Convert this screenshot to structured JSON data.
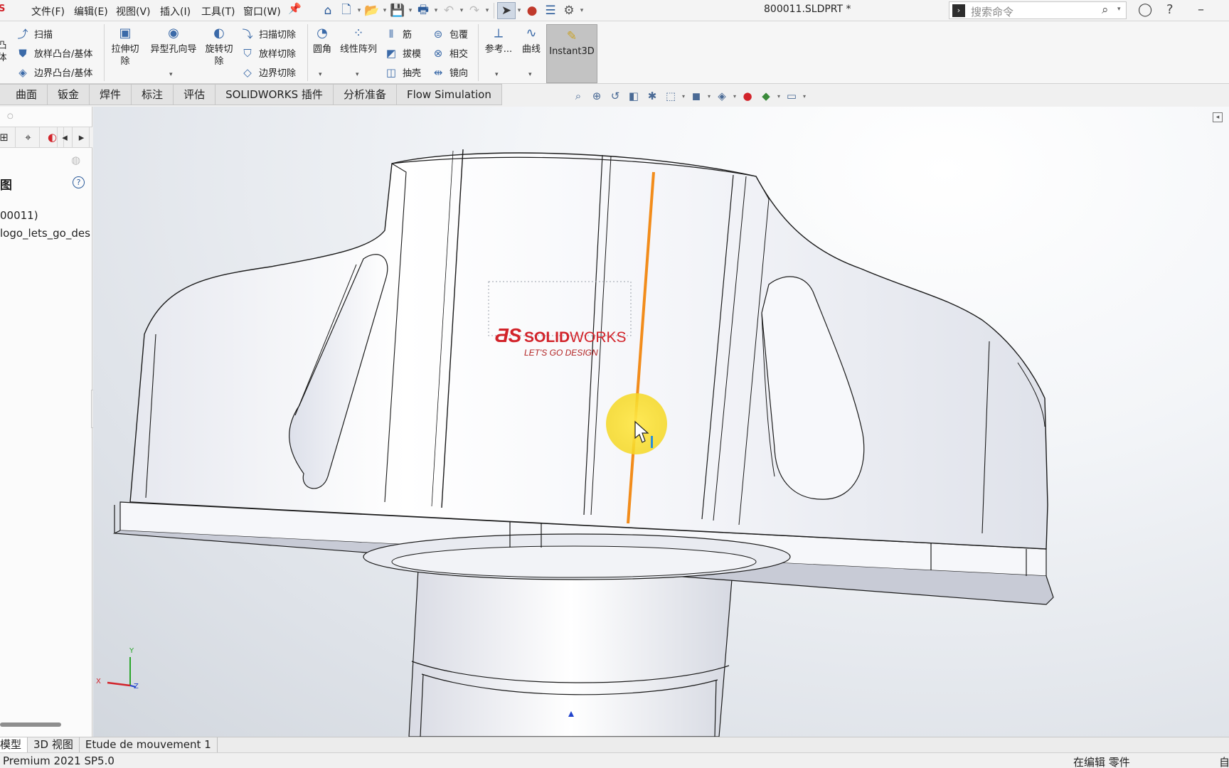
{
  "app": {
    "logo_text": "S"
  },
  "menu": [
    "文件(F)",
    "编辑(E)",
    "视图(V)",
    "插入(I)",
    "工具(T)",
    "窗口(W)"
  ],
  "quick_access": {
    "icons": [
      "home-icon",
      "new-document-icon",
      "open-icon",
      "save-icon",
      "print-icon",
      "undo-icon",
      "redo-icon",
      "select-icon",
      "rebuild-icon",
      "file-properties-icon",
      "options-icon"
    ]
  },
  "document_title": "800011.SLDPRT *",
  "search": {
    "placeholder": "搜索命令"
  },
  "ribbon": {
    "left_partial": [
      "凸",
      "体"
    ],
    "sweep": "扫描",
    "loft_boss": "放样凸台/基体",
    "boundary_boss": "边界凸台/基体",
    "extruded_cut": "拉伸切除",
    "hole_wizard": "异型孔向导",
    "revolved_cut": "旋转切除",
    "swept_cut": "扫描切除",
    "lofted_cut": "放样切除",
    "boundary_cut": "边界切除",
    "fillet": "圆角",
    "linear_pattern": "线性阵列",
    "rib": "筋",
    "draft": "拔模",
    "shell": "抽壳",
    "wrap": "包覆",
    "intersect": "相交",
    "mirror": "镜向",
    "reference": "参考...",
    "curves": "曲线",
    "instant3d": "Instant3D"
  },
  "cm_tabs": [
    "曲面",
    "钣金",
    "焊件",
    "标注",
    "评估",
    "SOLIDWORKS 插件",
    "分析准备",
    "Flow Simulation"
  ],
  "feature_tree": {
    "title": "图",
    "items": [
      "00011)",
      "logo_lets_go_des"
    ]
  },
  "viewport": {
    "logo_brand": "SOLIDWORKS",
    "logo_brand_bold": "SOLID",
    "logo_brand_light": "WORKS",
    "logo_tagline": "LET'S GO DESIGN",
    "triad": {
      "x": "X",
      "y": "Y",
      "z": "Z"
    },
    "colors": {
      "selected_edge": "#f28c1b",
      "cursor_highlight": "#ffe84d",
      "logo_red": "#d2232a"
    }
  },
  "bottom_tabs": [
    "模型",
    "3D 视图",
    "Etude de mouvement 1"
  ],
  "status": {
    "left": "Premium 2021 SP5.0",
    "right": "在编辑 零件",
    "right_cut": "自"
  }
}
